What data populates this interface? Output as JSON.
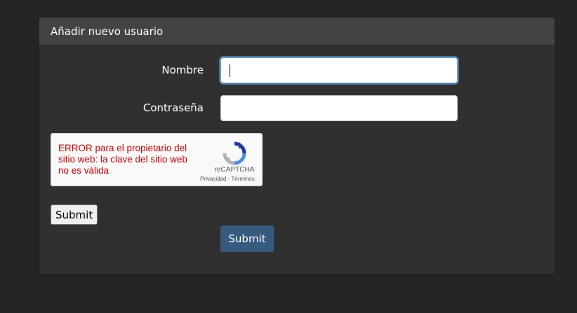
{
  "panel": {
    "title": "Añadir nuevo usuario"
  },
  "form": {
    "name_label": "Nombre",
    "name_value": "",
    "password_label": "Contraseña",
    "password_value": ""
  },
  "recaptcha": {
    "error": "ERROR para el propietario del sitio web: la clave del sitio web no es válida",
    "brand": "reCAPTCHA",
    "privacy_link": "Privacidad",
    "separator": "-",
    "terms_link": "Términos"
  },
  "buttons": {
    "native_submit": "Submit",
    "primary_submit": "Submit"
  },
  "colors": {
    "background": "#252525",
    "panel": "#303030",
    "panel_heading": "#434343",
    "primary": "#375a7f",
    "error": "#d00000"
  }
}
